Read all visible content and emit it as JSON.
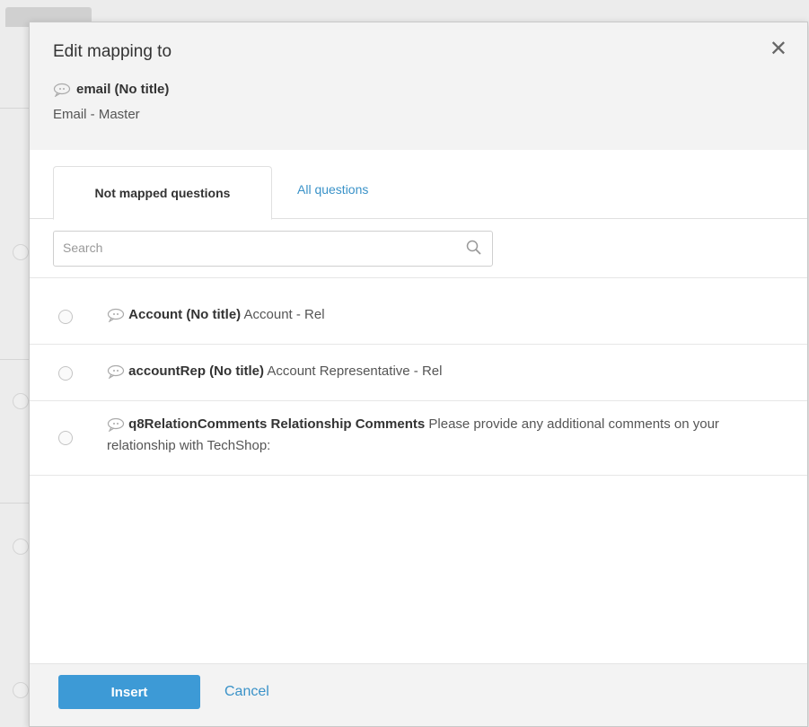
{
  "dialog": {
    "title": "Edit mapping to",
    "target_name": "email (No title)",
    "target_sub": "Email - Master",
    "close_glyph": "✕"
  },
  "tabs": [
    {
      "label": "Not mapped questions",
      "active": true
    },
    {
      "label": "All questions",
      "active": false
    }
  ],
  "search": {
    "placeholder": "Search",
    "value": ""
  },
  "questions": [
    {
      "name": "Account (No title)",
      "desc": "Account - Rel",
      "selected": false
    },
    {
      "name": "accountRep (No title)",
      "desc": "Account Representative - Rel",
      "selected": false
    },
    {
      "name": "q8RelationComments Relationship Comments",
      "desc": "Please provide any additional comments on your relationship with TechShop:",
      "selected": false
    }
  ],
  "footer": {
    "insert_label": "Insert",
    "cancel_label": "Cancel"
  },
  "colors": {
    "accent": "#3d9ad6",
    "link": "#3a92c8",
    "header_bg": "#f3f3f3"
  },
  "icons": {
    "question": "chat-bubble-icon",
    "search": "magnifier-icon",
    "close": "close-icon"
  }
}
